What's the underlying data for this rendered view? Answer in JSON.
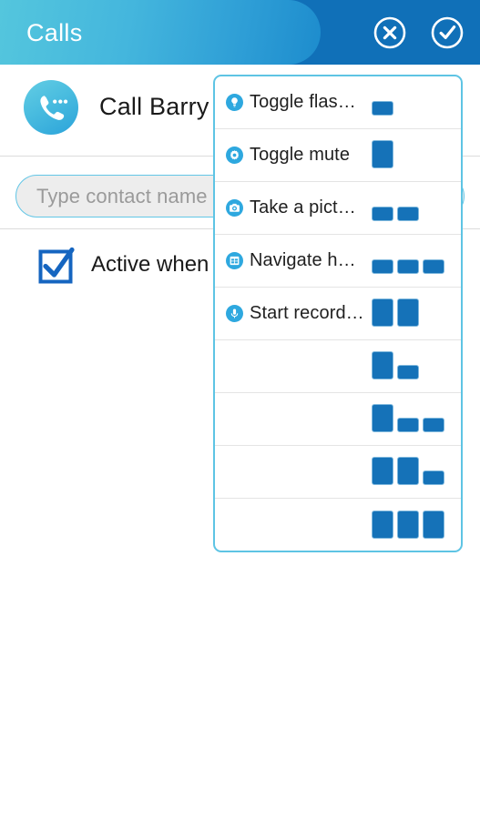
{
  "header": {
    "title": "Calls",
    "cancel_icon": "circle-x-icon",
    "confirm_icon": "circle-check-icon",
    "pill_gradient_start": "#54c6dd",
    "pill_gradient_end": "#1d8ccd",
    "background": "#1070b8"
  },
  "call_row": {
    "avatar_icon": "phone-call-icon",
    "text": "Call Barry",
    "caret_color": "#3fb6e3"
  },
  "contact_field": {
    "placeholder": "Type contact name",
    "value": "",
    "fill": "#ededed",
    "border": "#62c6e6"
  },
  "active_option": {
    "label": "Active when screen is off",
    "checked": true,
    "checkbox_color": "#1565c0"
  },
  "dropdown": {
    "border_color": "#5ec4e4",
    "block_color": "#1572b8",
    "rows": [
      {
        "icon": "lightbulb-icon",
        "label": "Toggle flas…",
        "blocks": [
          "short"
        ]
      },
      {
        "icon": "gear-icon",
        "label": "Toggle mute",
        "blocks": [
          "tall"
        ]
      },
      {
        "icon": "camera-icon",
        "label": "Take a pict…",
        "blocks": [
          "short",
          "short"
        ]
      },
      {
        "icon": "window-grid-icon",
        "label": "Navigate h…",
        "blocks": [
          "short",
          "short",
          "short"
        ]
      },
      {
        "icon": "microphone-icon",
        "label": "Start record…",
        "blocks": [
          "tall",
          "tall"
        ]
      },
      {
        "icon": "",
        "label": "",
        "blocks": [
          "tall",
          "short"
        ]
      },
      {
        "icon": "",
        "label": "",
        "blocks": [
          "tall",
          "short",
          "short"
        ]
      },
      {
        "icon": "",
        "label": "",
        "blocks": [
          "tall",
          "tall",
          "short"
        ]
      },
      {
        "icon": "",
        "label": "",
        "blocks": [
          "tall",
          "tall",
          "tall"
        ]
      }
    ]
  }
}
